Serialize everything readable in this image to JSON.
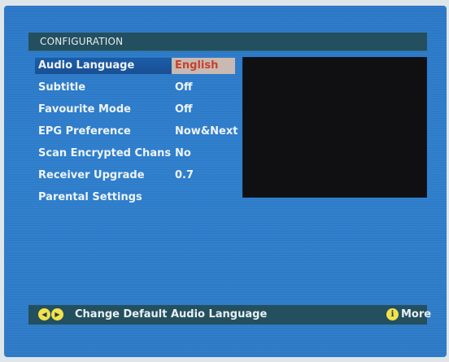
{
  "header": {
    "title": "CONFIGURATION"
  },
  "menu": {
    "items": [
      {
        "label": "Audio Language",
        "value": "English",
        "selected": true
      },
      {
        "label": "Subtitle",
        "value": "Off"
      },
      {
        "label": "Favourite Mode",
        "value": "Off"
      },
      {
        "label": "EPG Preference",
        "value": "Now&Next"
      },
      {
        "label": "Scan Encrypted Chans",
        "value": "No"
      },
      {
        "label": "Receiver Upgrade",
        "value": "0.7"
      },
      {
        "label": "Parental Settings",
        "value": ""
      }
    ]
  },
  "footer": {
    "left_arrow_icon": "arrow-left-icon",
    "right_arrow_icon": "arrow-right-icon",
    "hint": "Change Default Audio Language",
    "info_icon": "info-icon",
    "more_label": "More"
  },
  "colors": {
    "background": "#2c7ac8",
    "panel": "#244f5f",
    "selection": "#1a4f93",
    "value_highlight_bg": "#c8b9b2",
    "value_highlight_text": "#c8412c",
    "button_yellow": "#f2e24b"
  }
}
